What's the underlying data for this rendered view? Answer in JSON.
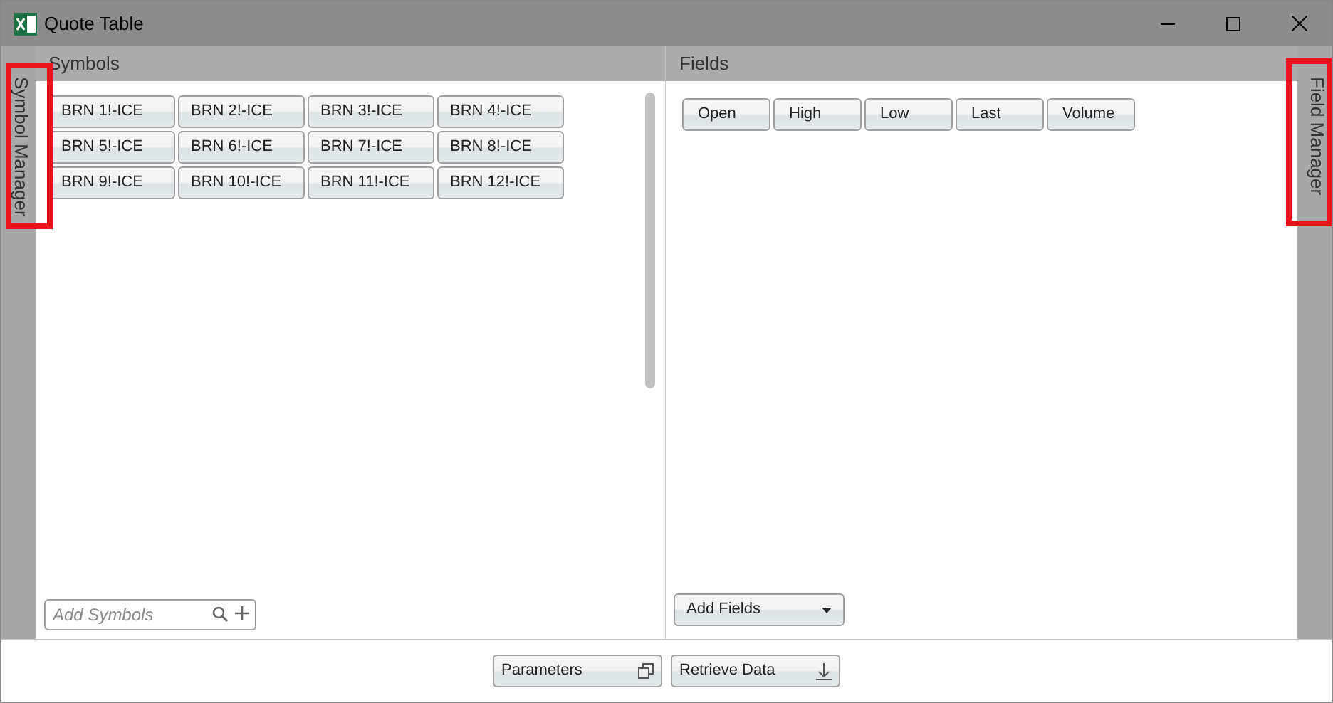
{
  "window": {
    "title": "Quote Table"
  },
  "side_tabs": {
    "left": "Symbol Manager",
    "right": "Field Manager"
  },
  "symbols": {
    "heading": "Symbols",
    "items": [
      "BRN 1!-ICE",
      "BRN 2!-ICE",
      "BRN 3!-ICE",
      "BRN 4!-ICE",
      "BRN 5!-ICE",
      "BRN 6!-ICE",
      "BRN 7!-ICE",
      "BRN 8!-ICE",
      "BRN 9!-ICE",
      "BRN 10!-ICE",
      "BRN 11!-ICE",
      "BRN 12!-ICE"
    ],
    "search": {
      "placeholder": "Add Symbols"
    }
  },
  "fields": {
    "heading": "Fields",
    "items": [
      "Open",
      "High",
      "Low",
      "Last",
      "Volume"
    ],
    "dropdown": "Add Fields"
  },
  "buttons": [
    "Parameters",
    "Retrieve Data"
  ]
}
